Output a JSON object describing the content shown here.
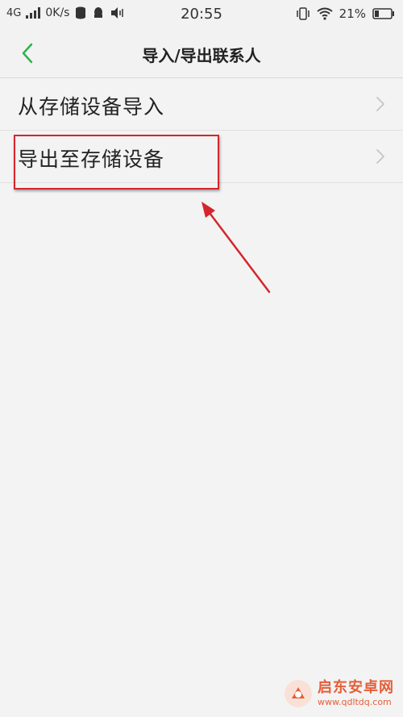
{
  "status_bar": {
    "network": "4G",
    "speed": "0K/s",
    "time": "20:55",
    "battery": "21%"
  },
  "header": {
    "title": "导入/导出联系人"
  },
  "list": {
    "items": [
      {
        "label": "从存储设备导入"
      },
      {
        "label": "导出至存储设备"
      }
    ]
  },
  "colors": {
    "accent": "#2db44a",
    "annotation": "#d4262c",
    "watermark": "#e4572e"
  },
  "watermark": {
    "name": "启东安卓网",
    "url": "www.qdltdq.com"
  }
}
